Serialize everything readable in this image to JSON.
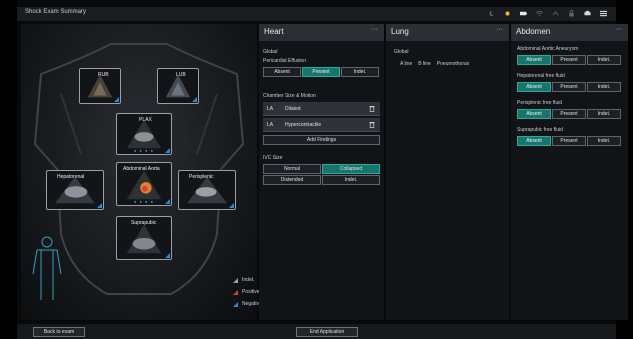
{
  "app": {
    "title": "Shock Exam Summary"
  },
  "system_icons": [
    "moon-icon",
    "sun-icon",
    "battery-icon",
    "wifi-icon",
    "network-icon",
    "lock-icon",
    "printer-icon",
    "menu-icon"
  ],
  "anatomy": {
    "views": [
      {
        "id": "view-rub",
        "label": "RUB"
      },
      {
        "id": "view-lub",
        "label": "LUB"
      },
      {
        "id": "view-plax",
        "label": "PLAX"
      },
      {
        "id": "view-aorta",
        "label": "Abdominal Aorta"
      },
      {
        "id": "view-hepatorenal",
        "label": "Hepatorenal"
      },
      {
        "id": "view-perisplenic",
        "label": "Perisplenic"
      },
      {
        "id": "view-suprapubic",
        "label": "Suprapubic"
      }
    ],
    "legend": [
      {
        "label": "Indet.",
        "color": "#9aa0a8"
      },
      {
        "label": "Positive",
        "color": "#d94141"
      },
      {
        "label": "Negative",
        "color": "#2a8ad6"
      }
    ]
  },
  "heart": {
    "title": "Heart",
    "more": "···",
    "global_label": "Global",
    "pericardial": {
      "label": "Pericardial Effusion",
      "options": [
        "Absent",
        "Present",
        "Indet."
      ],
      "selected": "Present"
    },
    "chamber": {
      "label": "Chamber Size & Motion",
      "findings": [
        {
          "site": "LA",
          "value": "Dilated"
        },
        {
          "site": "LA",
          "value": "Hypercontractile"
        }
      ],
      "add_label": "Add Findings"
    },
    "ivc": {
      "label": "IVC Size",
      "options": [
        "Normal",
        "Collapsed",
        "Distended",
        "Indet."
      ],
      "selected": "Collapsed"
    }
  },
  "lung": {
    "title": "Lung",
    "more": "···",
    "global_label": "Global",
    "findings": [
      "A line",
      "B line",
      "Pneumothorax"
    ]
  },
  "abdomen": {
    "title": "Abdomen",
    "more": "···",
    "groups": [
      {
        "label": "Abdominal Aortic Aneurysm",
        "options": [
          "Absent",
          "Present",
          "Indet."
        ],
        "selected": "Absent"
      },
      {
        "label": "Hepatorenal free fluid",
        "options": [
          "Absent",
          "Present",
          "Indet."
        ],
        "selected": "Absent"
      },
      {
        "label": "Perisplenic free fluid",
        "options": [
          "Absent",
          "Present",
          "Indet."
        ],
        "selected": "Absent"
      },
      {
        "label": "Suprapubic free fluid",
        "options": [
          "Absent",
          "Present",
          "Indet."
        ],
        "selected": "Absent"
      }
    ]
  },
  "footer": {
    "back_label": "Back to exam",
    "end_label": "End Application"
  },
  "colors": {
    "accent": "#18756c",
    "positive": "#d94141",
    "negative": "#2a8ad6"
  }
}
